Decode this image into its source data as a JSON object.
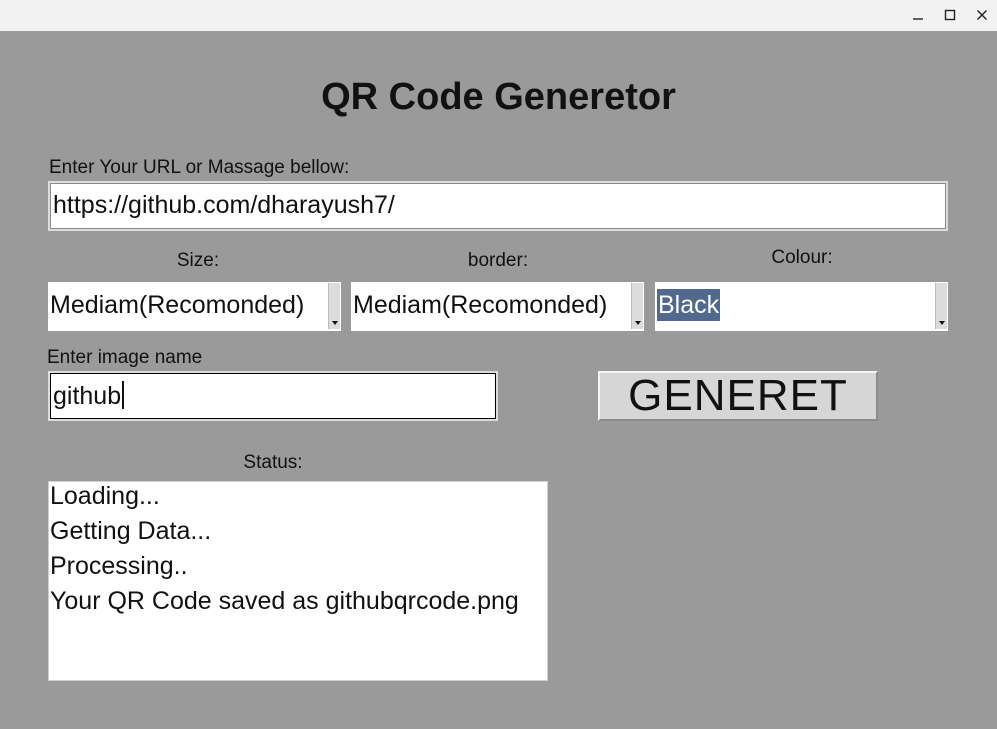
{
  "app": {
    "title": "QR Code Generetor"
  },
  "url_field": {
    "label": "Enter Your URL or Massage bellow:",
    "value": "https://github.com/dharayush7/"
  },
  "size": {
    "label": "Size:",
    "value": "Mediam(Recomonded)"
  },
  "border": {
    "label": "border:",
    "value": "Mediam(Recomonded)"
  },
  "colour": {
    "label": "Colour:",
    "value": "Black"
  },
  "image_name": {
    "label": "Enter image name",
    "value": "github"
  },
  "generate_button": {
    "label": "GENERET"
  },
  "status": {
    "label": "Status:",
    "lines": [
      "Loading...",
      "Getting Data...",
      "Processing..",
      "Your QR Code saved as githubqrcode.png"
    ]
  },
  "window_controls": {
    "minimize_icon": "minimize-icon",
    "maximize_icon": "maximize-icon",
    "close_icon": "close-icon"
  },
  "colors": {
    "window_bg": "#9a9a9a",
    "titlebar_bg": "#f2f2f2",
    "selection_bg": "#51698c"
  }
}
